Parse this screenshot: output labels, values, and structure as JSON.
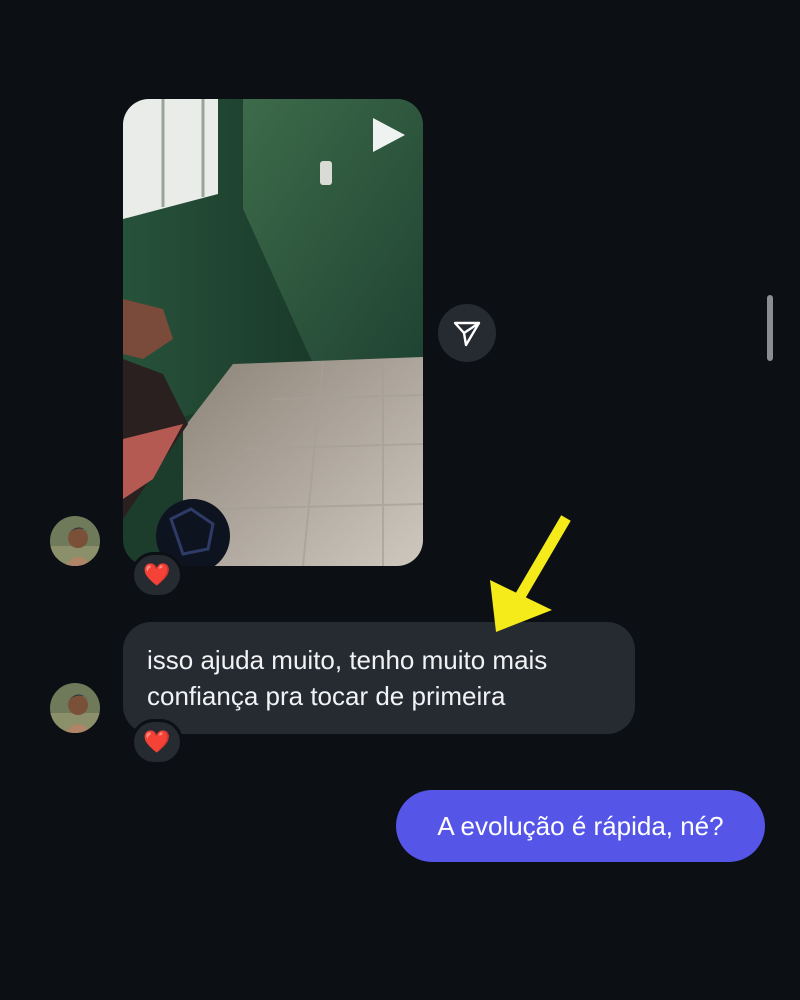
{
  "thread": {
    "video_message": {
      "icon": "play-icon",
      "reaction": "❤️",
      "share_icon": "send-icon"
    },
    "incoming_text_message": {
      "lines": [
        "isso ajuda muito, tenho muito mais",
        "confiança pra tocar de primeira"
      ],
      "reaction": "❤️"
    },
    "outgoing_text_message": {
      "text": "A evolução é rápida, né?"
    }
  },
  "annotation": {
    "type": "arrow",
    "color": "#f5ea1a"
  },
  "colors": {
    "background": "#0c0f14",
    "incoming_bubble": "#262a31",
    "outgoing_bubble": "#5556e8"
  }
}
